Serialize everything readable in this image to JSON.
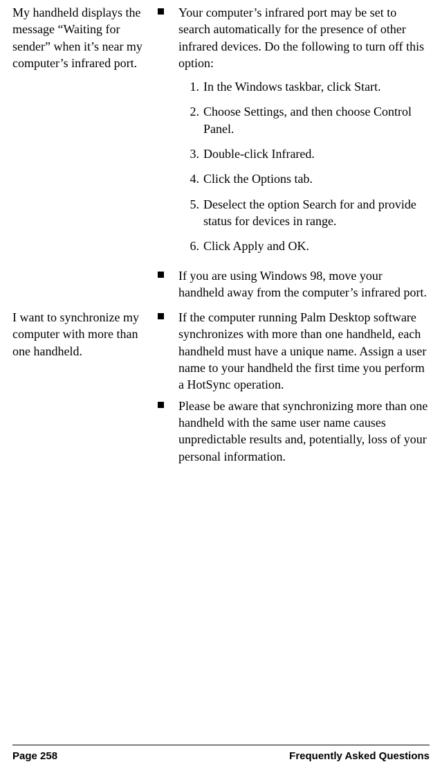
{
  "qa": [
    {
      "question": "My handheld displays the message “Waiting for sender” when it’s near my computer’s infrared port.",
      "bullets": [
        {
          "text": "Your computer’s infrared port may be set to search automatically for the presence of other infrared devices. Do the following to turn off this option:",
          "steps": [
            "In the Windows taskbar, click Start.",
            "Choose Settings, and then choose Control Panel.",
            "Double-click Infrared.",
            "Click the Options tab.",
            "Deselect the option Search for and provide status for devices in range.",
            "Click Apply and OK."
          ]
        },
        {
          "text": "If you are using Windows 98, move your handheld away from the computer’s infrared port."
        }
      ]
    },
    {
      "question": "I want to synchronize my computer with more than one handheld.",
      "bullets": [
        {
          "text": "If the computer running Palm Desktop software synchronizes with more than one handheld, each handheld must have a unique name. Assign a user name to your handheld the first time you perform a HotSync operation."
        },
        {
          "text": "Please be aware that synchronizing more than one handheld with the same user name causes unpredictable results and, potentially, loss of your personal information."
        }
      ]
    }
  ],
  "footer": {
    "page": "Page 258",
    "title": "Frequently Asked Questions"
  }
}
